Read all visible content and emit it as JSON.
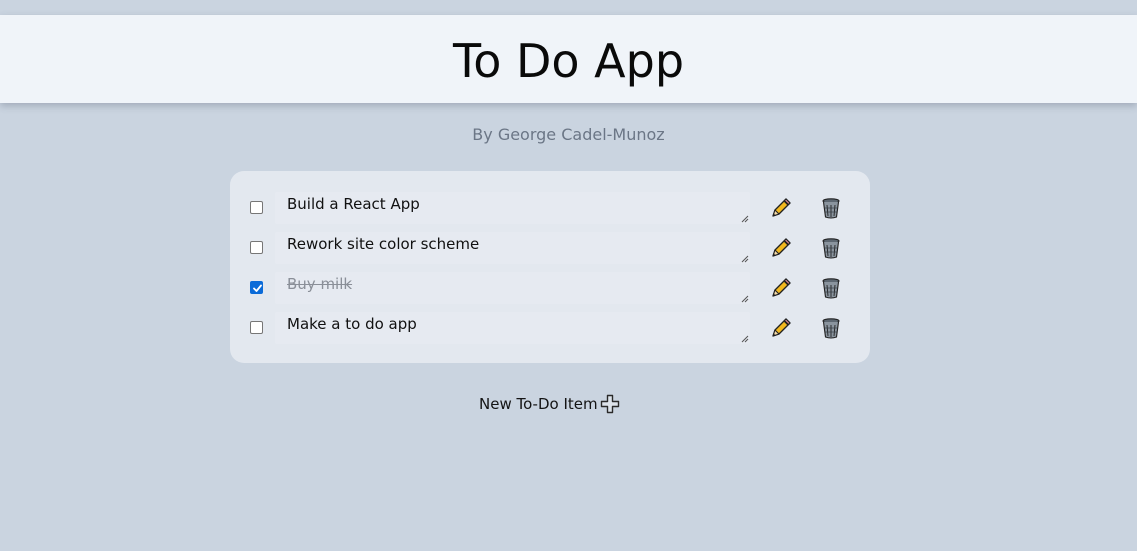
{
  "header": {
    "title": "To Do App"
  },
  "author": "By George Cadel-Munoz",
  "todos": [
    {
      "text": "Build a React App",
      "completed": false,
      "edit_icon": "pencil-icon",
      "delete_icon": "trash-can-icon"
    },
    {
      "text": "Rework site color scheme",
      "completed": false,
      "edit_icon": "pencil-icon",
      "delete_icon": "trash-can-icon"
    },
    {
      "text": "Buy milk",
      "completed": true,
      "edit_icon": "pencil-icon",
      "delete_icon": "trash-can-icon"
    },
    {
      "text": "Make a to do app",
      "completed": false,
      "edit_icon": "pencil-icon",
      "delete_icon": "trash-can-icon"
    }
  ],
  "new_item": {
    "label": "New To-Do Item",
    "icon": "plus-icon"
  },
  "colors": {
    "background": "#cad4e0",
    "header": "#f0f4f9",
    "card": "#e3e8ef",
    "checkbox_checked": "#0b6bd8",
    "pencil": "#f2b81e"
  }
}
